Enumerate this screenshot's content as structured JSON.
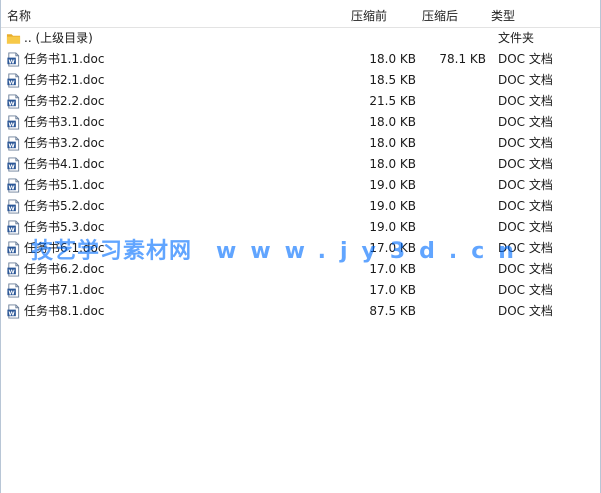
{
  "columns": {
    "name": "名称",
    "compressed": "压缩前",
    "size": "压缩后",
    "type": "类型"
  },
  "parent": {
    "name": ".. (上级目录)",
    "type": "文件夹",
    "icon": "folder-icon"
  },
  "files": [
    {
      "name": "任务书1.1.doc",
      "compressed": "18.0 KB",
      "size": "78.1 KB",
      "type": "DOC 文档",
      "icon": "word-doc-icon"
    },
    {
      "name": "任务书2.1.doc",
      "compressed": "18.5 KB",
      "size": "",
      "type": "DOC 文档",
      "icon": "word-doc-icon"
    },
    {
      "name": "任务书2.2.doc",
      "compressed": "21.5 KB",
      "size": "",
      "type": "DOC 文档",
      "icon": "word-doc-icon"
    },
    {
      "name": "任务书3.1.doc",
      "compressed": "18.0 KB",
      "size": "",
      "type": "DOC 文档",
      "icon": "word-doc-icon"
    },
    {
      "name": "任务书3.2.doc",
      "compressed": "18.0 KB",
      "size": "",
      "type": "DOC 文档",
      "icon": "word-doc-icon"
    },
    {
      "name": "任务书4.1.doc",
      "compressed": "18.0 KB",
      "size": "",
      "type": "DOC 文档",
      "icon": "word-doc-icon"
    },
    {
      "name": "任务书5.1.doc",
      "compressed": "19.0 KB",
      "size": "",
      "type": "DOC 文档",
      "icon": "word-doc-icon"
    },
    {
      "name": "任务书5.2.doc",
      "compressed": "19.0 KB",
      "size": "",
      "type": "DOC 文档",
      "icon": "word-doc-icon"
    },
    {
      "name": "任务书5.3.doc",
      "compressed": "19.0 KB",
      "size": "",
      "type": "DOC 文档",
      "icon": "word-doc-icon"
    },
    {
      "name": "任务书6.1.doc",
      "compressed": "17.0 KB",
      "size": "",
      "type": "DOC 文档",
      "icon": "word-doc-icon"
    },
    {
      "name": "任务书6.2.doc",
      "compressed": "17.0 KB",
      "size": "",
      "type": "DOC 文档",
      "icon": "word-doc-icon"
    },
    {
      "name": "任务书7.1.doc",
      "compressed": "17.0 KB",
      "size": "",
      "type": "DOC 文档",
      "icon": "word-doc-icon"
    },
    {
      "name": "任务书8.1.doc",
      "compressed": "87.5 KB",
      "size": "",
      "type": "DOC 文档",
      "icon": "word-doc-icon"
    }
  ],
  "watermark": {
    "brand": "技艺学习素材网",
    "url": "www.jy3d.cn"
  },
  "colors": {
    "folder": "#f5c342",
    "word_icon": "#2b5797",
    "watermark": "#1a73ff"
  }
}
